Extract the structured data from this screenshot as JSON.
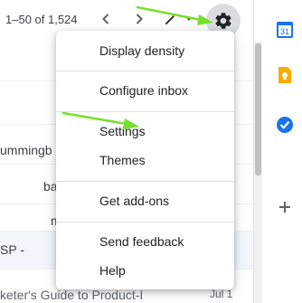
{
  "toolbar": {
    "pager_text": "1–50 of 1,524",
    "icons": {
      "prev": "chevron-left-icon",
      "next": "chevron-right-icon",
      "input_tools": "pencil-icon",
      "input_tools_menu": "caret-down-icon",
      "settings": "gear-icon"
    }
  },
  "email_list": {
    "rows": [
      {
        "text": "ummingb"
      },
      {
        "text": "ba"
      },
      {
        "text": "m"
      },
      {
        "text": "SP -"
      },
      {
        "text": "keter's Guide to Product-I",
        "date": "Jul 1"
      }
    ]
  },
  "settings_menu": {
    "items": [
      {
        "label": "Display density"
      },
      {
        "label": "Configure inbox"
      },
      {
        "label": "Settings"
      },
      {
        "label": "Themes"
      },
      {
        "label": "Get add-ons"
      },
      {
        "label": "Send feedback"
      },
      {
        "label": "Help"
      }
    ]
  },
  "side_panel": {
    "calendar_day": "31",
    "icons": [
      "calendar-icon",
      "keep-icon",
      "tasks-icon",
      "add-icon"
    ]
  },
  "colors": {
    "annotation_arrow": "#76e02a",
    "gear_highlight": "#dadce0",
    "calendar_blue": "#1a73e8",
    "keep_yellow": "#f9ab00",
    "tasks_blue": "#1a73e8"
  }
}
